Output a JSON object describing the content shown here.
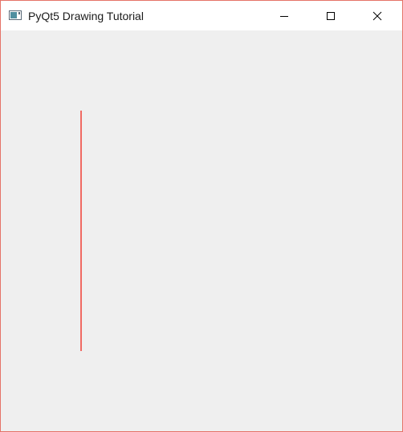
{
  "window": {
    "title": "PyQt5 Drawing Tutorial",
    "icons": {
      "app": "window-app-icon",
      "minimize": "minimize-icon",
      "maximize": "maximize-icon",
      "close": "close-icon"
    },
    "colors": {
      "border": "#e57368",
      "titlebar_bg": "#ffffff",
      "client_bg": "#efefef"
    }
  },
  "canvas": {
    "line_color": "#f06a63"
  }
}
